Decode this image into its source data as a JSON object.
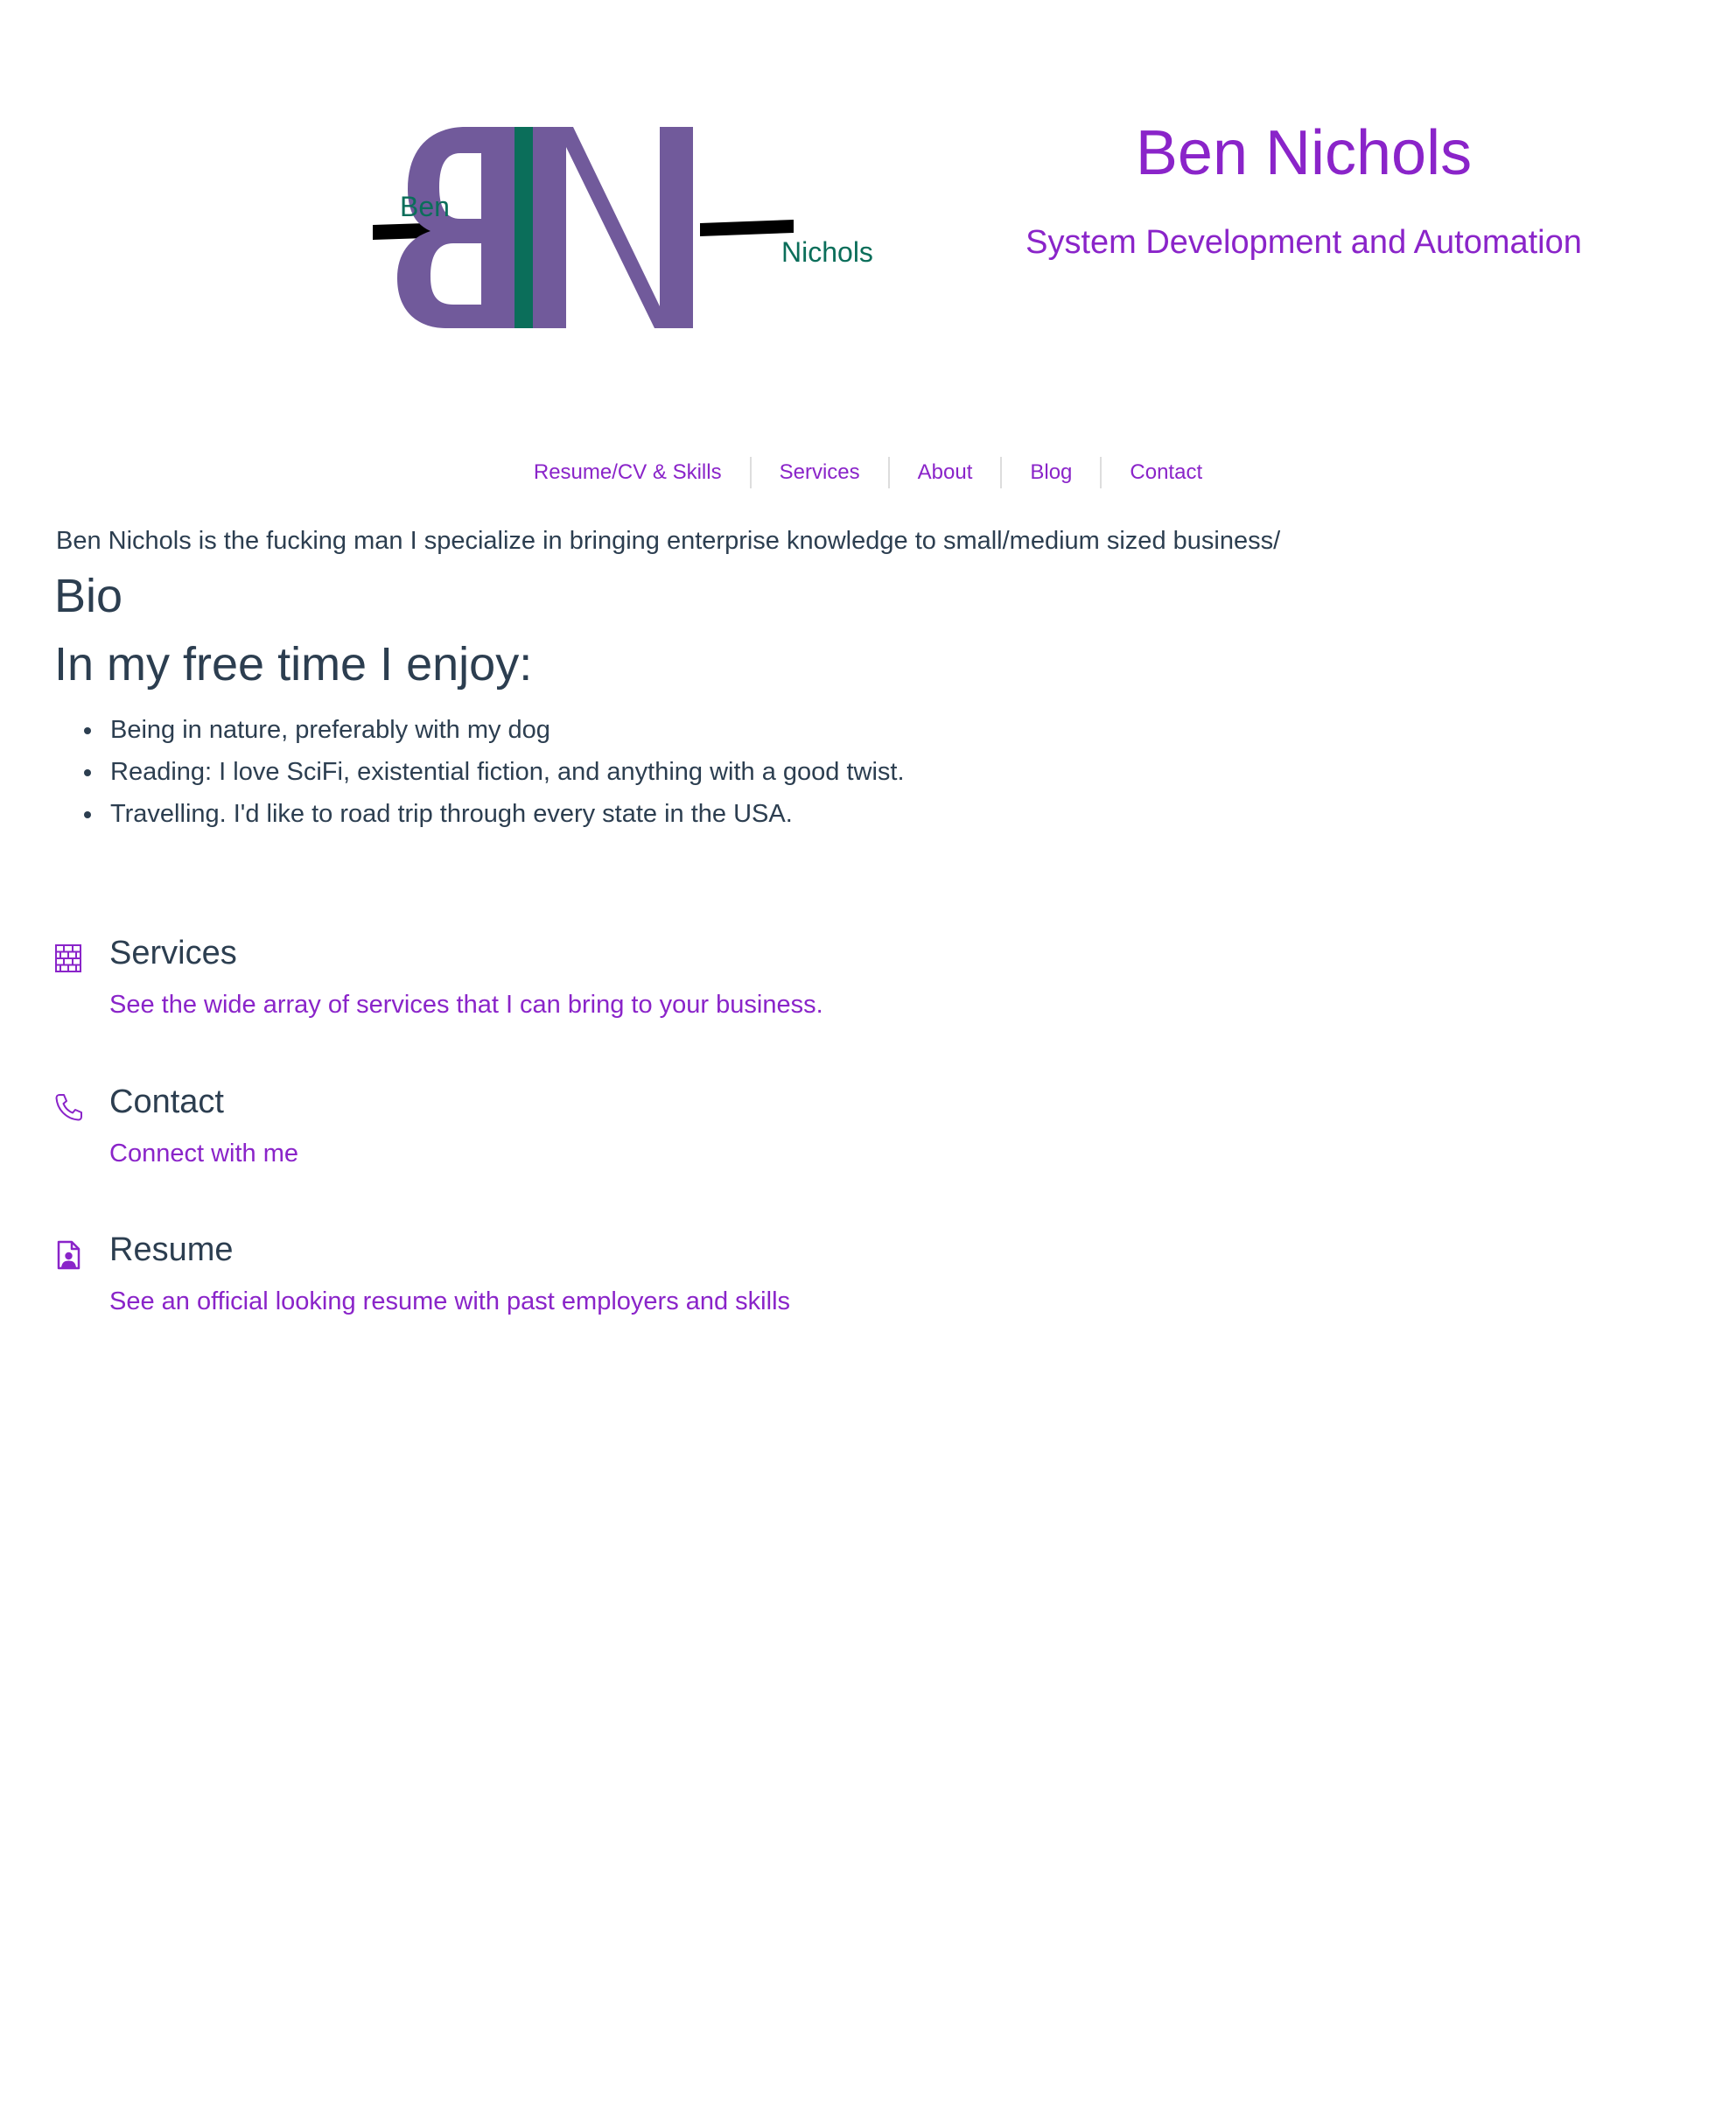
{
  "brand": {
    "logo_first": "Ben",
    "logo_last": "Nichols",
    "logo_letters": "BN",
    "logo_colors": {
      "letters": "#715a9b",
      "stripe": "#0b6e5a",
      "bars": "#000000"
    },
    "title": "Ben Nichols",
    "tagline": "System Development and Automation",
    "accent_color": "#8a24c9"
  },
  "nav": {
    "items": [
      {
        "label": "Resume/CV & Skills"
      },
      {
        "label": "Services"
      },
      {
        "label": "About"
      },
      {
        "label": "Blog"
      },
      {
        "label": "Contact"
      }
    ]
  },
  "main": {
    "intro": "Ben Nichols is the fucking man I specialize in bringing enterprise knowledge to small/medium sized business/",
    "bio_heading": "Bio",
    "free_time_heading": "In my free time I enjoy:",
    "enjoy_items": [
      "Being in nature, preferably with my dog",
      "Reading: I love SciFi, existential fiction, and anything with a good twist.",
      "Travelling. I'd like to road trip through every state in the USA."
    ]
  },
  "features": [
    {
      "icon": "brick-wall-icon",
      "title": "Services",
      "link": "See the wide array of services that I can bring to your business."
    },
    {
      "icon": "phone-icon",
      "title": "Contact",
      "link": "Connect with me"
    },
    {
      "icon": "resume-file-icon",
      "title": "Resume",
      "link": "See an official looking resume with past employers and skills"
    }
  ]
}
